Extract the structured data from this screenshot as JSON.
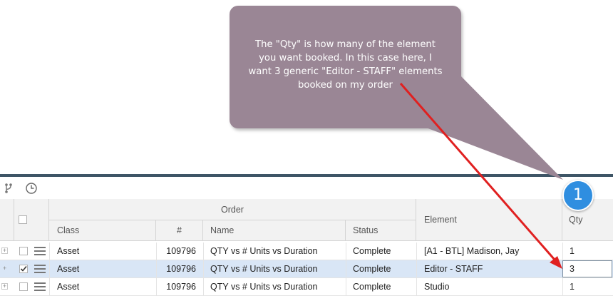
{
  "callout": {
    "lines": [
      "The \"Qty\" is how many of the element",
      "you want booked.  In this case here, I",
      "want 3 generic \"Editor - STAFF\" elements",
      "booked on my order"
    ],
    "color": "#9a8695"
  },
  "badge": {
    "label": "1",
    "color": "#2f8ee0"
  },
  "arrow_color": "#e02020",
  "toolbar": {
    "buttons": [
      {
        "icon": "hierarchy-icon"
      },
      {
        "icon": "clock-icon"
      }
    ]
  },
  "grid": {
    "group_header": "Order",
    "columns": {
      "class": "Class",
      "number": "#",
      "name": "Name",
      "status": "Status",
      "element": "Element",
      "qty": "Qty"
    },
    "rows": [
      {
        "expander": "+",
        "checked": false,
        "selected": false,
        "class": "Asset",
        "number": "109796",
        "name": "QTY vs # Units vs Duration",
        "status": "Complete",
        "element": "[A1 - BTL] Madison, Jay",
        "qty": "1"
      },
      {
        "expander": "+",
        "checked": true,
        "selected": true,
        "class": "Asset",
        "number": "109796",
        "name": "QTY vs # Units vs Duration",
        "status": "Complete",
        "element": "Editor - STAFF",
        "qty": "3"
      },
      {
        "expander": "+",
        "checked": false,
        "selected": false,
        "class": "Asset",
        "number": "109796",
        "name": "QTY vs # Units vs Duration",
        "status": "Complete",
        "element": "Studio",
        "qty": "1"
      }
    ]
  },
  "colors": {
    "header_bar": "#3e5566",
    "selected_row": "#d9e6f6"
  }
}
